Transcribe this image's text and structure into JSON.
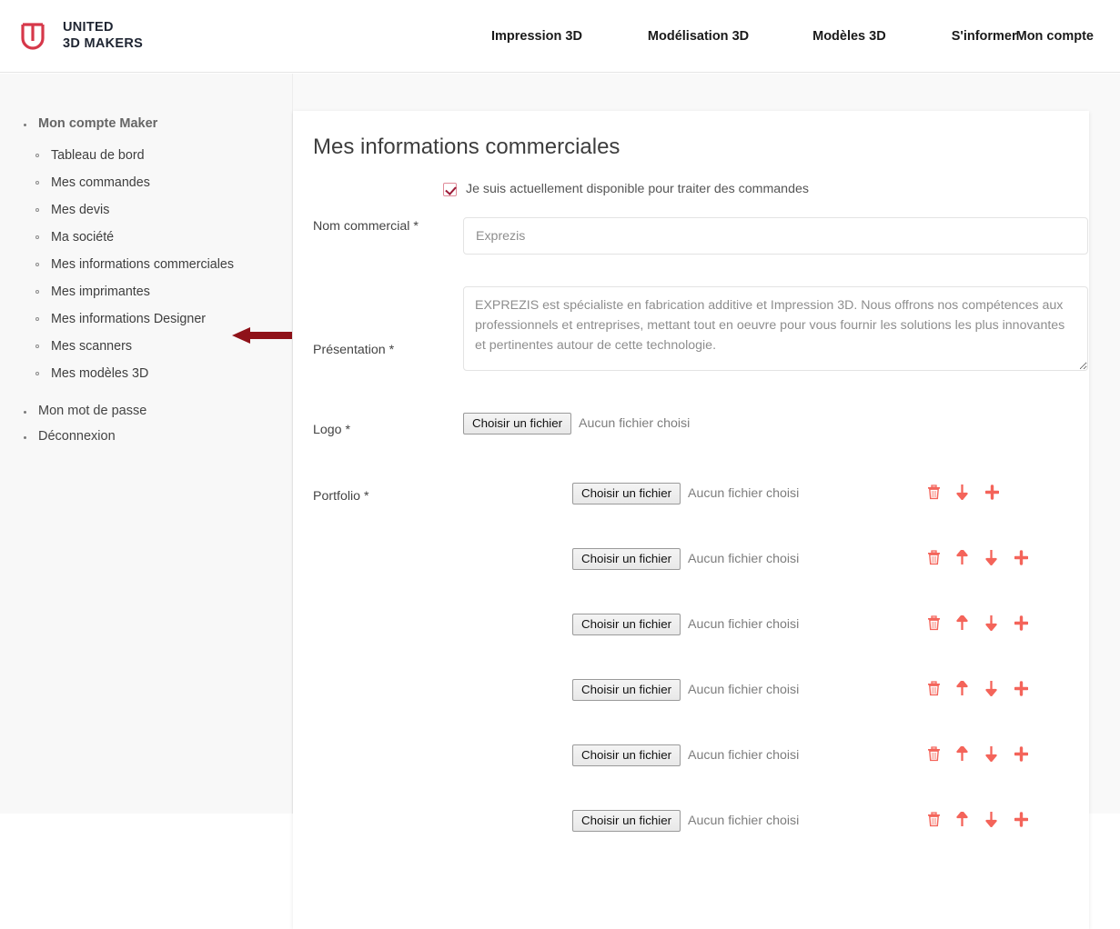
{
  "header": {
    "brand": {
      "line1": "UNITED",
      "line2": "3D MAKERS",
      "color": "#d6384a"
    },
    "nav": [
      {
        "label": "Impression 3D"
      },
      {
        "label": "Modélisation 3D"
      },
      {
        "label": "Modèles 3D"
      },
      {
        "label": "S'informer"
      }
    ],
    "account": "Mon compte"
  },
  "sidebar": {
    "root_items": [
      {
        "label": "Mon compte Maker",
        "bold": true
      },
      {
        "label": "Mon mot de passe",
        "bold": false
      },
      {
        "label": "Déconnexion",
        "bold": false
      }
    ],
    "sub_items": [
      {
        "label": "Tableau de bord"
      },
      {
        "label": "Mes commandes"
      },
      {
        "label": "Mes devis"
      },
      {
        "label": "Ma société"
      },
      {
        "label": "Mes informations commerciales"
      },
      {
        "label": "Mes imprimantes"
      },
      {
        "label": "Mes informations Designer"
      },
      {
        "label": "Mes scanners"
      },
      {
        "label": "Mes modèles 3D"
      }
    ],
    "annotation_arrow_color": "#8f1219",
    "annotation_target": "Mes informations commerciales"
  },
  "panel": {
    "title": "Mes informations commerciales",
    "availability": {
      "label": "Je suis actuellement disponible pour traiter des commandes",
      "checked": true,
      "accent": "#9c1b38"
    },
    "fields": {
      "nom_commercial": {
        "label": "Nom commercial *",
        "value": "Exprezis"
      },
      "presentation": {
        "label": "Présentation *",
        "value": "EXPREZIS est spécialiste en fabrication additive et Impression 3D. Nous offrons nos compétences aux professionnels et entreprises, mettant tout en oeuvre pour vous fournir les solutions les plus innovantes et pertinentes autour de cette technologie."
      },
      "logo": {
        "label": "Logo *",
        "button": "Choisir un fichier",
        "status": "Aucun fichier choisi"
      },
      "portfolio": {
        "label": "Portfolio *",
        "icon_color": "#f4645a",
        "rows": [
          {
            "button": "Choisir un fichier",
            "status": "Aucun fichier choisi",
            "actions": [
              "trash-icon",
              "arrow-down-icon",
              "plus-icon"
            ]
          },
          {
            "button": "Choisir un fichier",
            "status": "Aucun fichier choisi",
            "actions": [
              "trash-icon",
              "arrow-up-icon",
              "arrow-down-icon",
              "plus-icon"
            ]
          },
          {
            "button": "Choisir un fichier",
            "status": "Aucun fichier choisi",
            "actions": [
              "trash-icon",
              "arrow-up-icon",
              "arrow-down-icon",
              "plus-icon"
            ]
          },
          {
            "button": "Choisir un fichier",
            "status": "Aucun fichier choisi",
            "actions": [
              "trash-icon",
              "arrow-up-icon",
              "arrow-down-icon",
              "plus-icon"
            ]
          },
          {
            "button": "Choisir un fichier",
            "status": "Aucun fichier choisi",
            "actions": [
              "trash-icon",
              "arrow-up-icon",
              "arrow-down-icon",
              "plus-icon"
            ]
          },
          {
            "button": "Choisir un fichier",
            "status": "Aucun fichier choisi",
            "actions": [
              "trash-icon",
              "arrow-up-icon",
              "arrow-down-icon",
              "plus-icon"
            ]
          }
        ]
      }
    }
  }
}
